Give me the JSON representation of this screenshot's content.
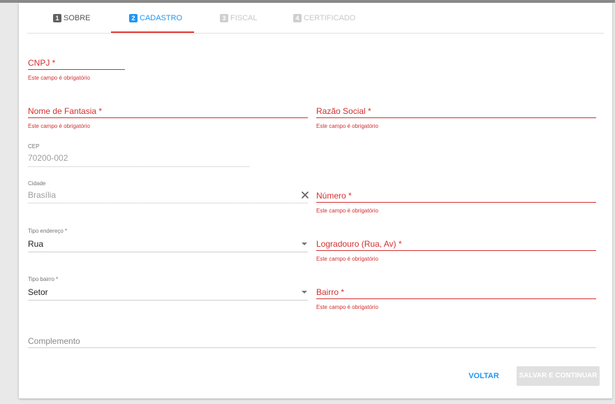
{
  "steps": [
    {
      "num": "1",
      "label": "SOBRE"
    },
    {
      "num": "2",
      "label": "CADASTRO"
    },
    {
      "num": "3",
      "label": "FISCAL"
    },
    {
      "num": "4",
      "label": "CERTIFICADO"
    }
  ],
  "form": {
    "cnpj": {
      "label": "CNPJ *",
      "error": "Este campo é obrigatório"
    },
    "nome_fantasia": {
      "label": "Nome de Fantasia *",
      "error": "Este campo é obrigatório"
    },
    "razao_social": {
      "label": "Razão Social *",
      "error": "Este campo é obrigatório"
    },
    "cep": {
      "label": "CEP",
      "value": "70200-002"
    },
    "cidade": {
      "label": "Cidade",
      "value": "Brasília"
    },
    "numero": {
      "label": "Número *",
      "error": "Este campo é obrigatório"
    },
    "tipo_endereco": {
      "label": "Tipo endereço *",
      "value": "Rua"
    },
    "logradouro": {
      "label": "Logradouro (Rua, Av) *",
      "error": "Este campo é obrigatório"
    },
    "tipo_bairro": {
      "label": "Tipo bairro *",
      "value": "Setor"
    },
    "bairro": {
      "label": "Bairro *",
      "error": "Este campo é obrigatório"
    },
    "complemento": {
      "placeholder": "Complemento"
    }
  },
  "actions": {
    "voltar": "VOLTAR",
    "salvar": "SALVAR E CONTINUAR"
  },
  "colors": {
    "accent": "#2196f3",
    "error": "#d32f2f",
    "disabled": "#e0e0e0"
  }
}
